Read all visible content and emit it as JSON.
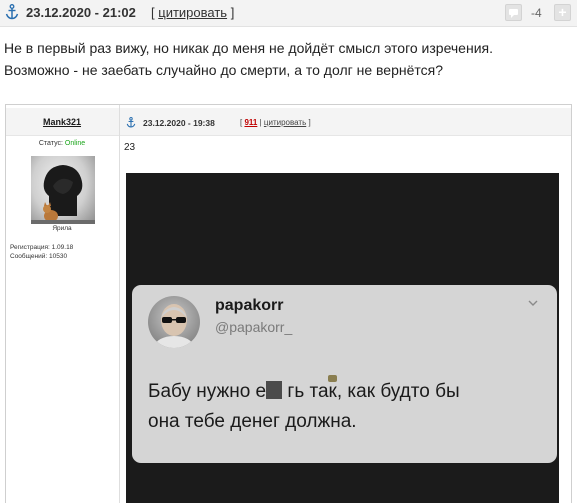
{
  "post": {
    "date": "23.12.2020 - 21:02",
    "quote_open": "[",
    "quote_label": "цитировать",
    "quote_close": "]",
    "rating": "-4",
    "text_line1": "Не в первый раз вижу, но никак до меня не дойдёт смысл этого изречения.",
    "text_line2": "Возможно - не заебать случайно до смерти, а то долг не вернётся?"
  },
  "embedded": {
    "username": "Mank321",
    "status_label": "Статус:",
    "status_value": "Online",
    "avatar_caption": "Ярила",
    "registration": "Регистрация: 1.09.18",
    "messages": "Сообщений: 10530",
    "date": "23.12.2020 - 19:38",
    "post_number": "911",
    "quote_label": "цитировать",
    "body_text": "23",
    "tweet": {
      "name": "papakorr",
      "handle": "@papakorr_",
      "line1_before": "Бабу нужно е",
      "line1_after": "гь так, как будто бы",
      "line2": "она тебе денег должна."
    }
  },
  "colors": {
    "online": "#1aa51a",
    "post_number": "#c00000",
    "header_bg": "#f3f3f3"
  },
  "icons": [
    "anchor-icon",
    "vote-down-icon",
    "vote-up-icon",
    "chevron-down-icon"
  ]
}
